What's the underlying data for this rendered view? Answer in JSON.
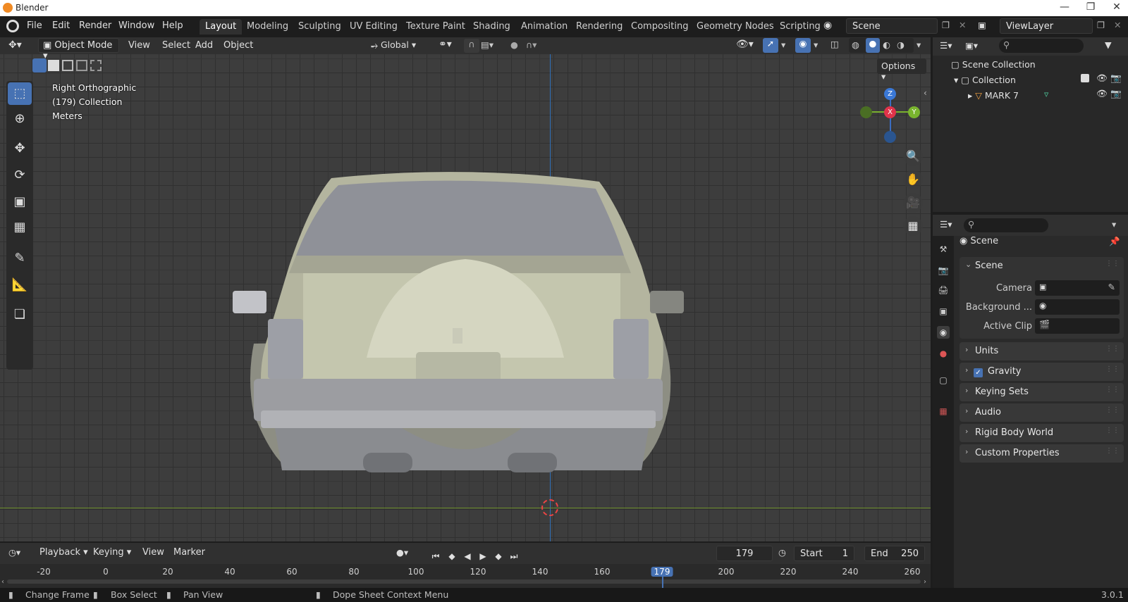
{
  "app": {
    "title": "Blender",
    "version": "3.0.1"
  },
  "menus": [
    "File",
    "Edit",
    "Render",
    "Window",
    "Help"
  ],
  "workspaces": [
    "Layout",
    "Modeling",
    "Sculpting",
    "UV Editing",
    "Texture Paint",
    "Shading",
    "Animation",
    "Rendering",
    "Compositing",
    "Geometry Nodes",
    "Scripting"
  ],
  "scene_field": "Scene",
  "viewlayer_field": "ViewLayer",
  "viewport_header": {
    "mode": "Object Mode",
    "menus": [
      "View",
      "Select",
      "Add",
      "Object"
    ],
    "orientation": "Global",
    "options": "Options"
  },
  "overlay_info": {
    "view": "Right Orthographic",
    "collection": "(179) Collection",
    "units": "Meters"
  },
  "gizmo": {
    "z": "Z",
    "x": "X",
    "y": "Y"
  },
  "outliner": {
    "root": "Scene Collection",
    "collection": "Collection",
    "object": "MARK 7"
  },
  "properties": {
    "context": "Scene",
    "panel_scene": "Scene",
    "camera_label": "Camera",
    "background_label": "Background ...",
    "active_clip_label": "Active Clip",
    "panels": [
      "Units",
      "Gravity",
      "Keying Sets",
      "Audio",
      "Rigid Body World",
      "Custom Properties"
    ]
  },
  "timeline": {
    "menus": [
      "Playback",
      "Keying",
      "View",
      "Marker"
    ],
    "current_frame": "179",
    "start_label": "Start",
    "start": "1",
    "end_label": "End",
    "end": "250",
    "ticks": [
      "-20",
      "0",
      "20",
      "40",
      "60",
      "80",
      "100",
      "120",
      "140",
      "160",
      "179",
      "200",
      "220",
      "240",
      "260"
    ]
  },
  "status": {
    "change_frame": "Change Frame",
    "box_select": "Box Select",
    "pan_view": "Pan View",
    "context_menu": "Dope Sheet Context Menu"
  }
}
